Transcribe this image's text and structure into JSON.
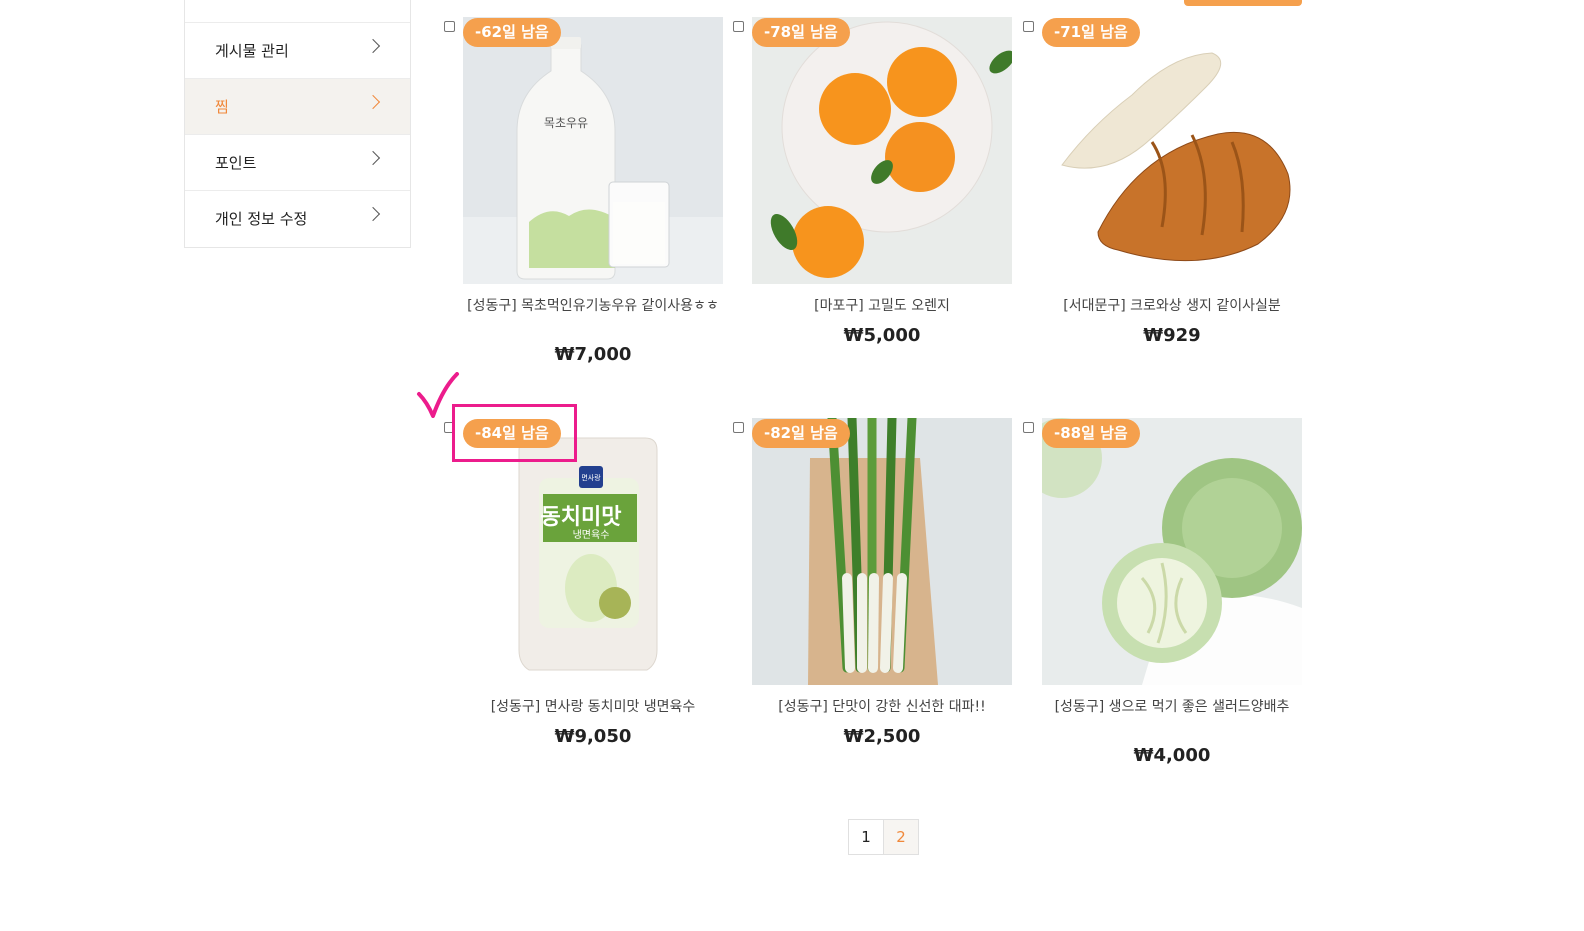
{
  "sidebar": {
    "items": [
      {
        "label": "게시물 관리"
      },
      {
        "label": "찜"
      },
      {
        "label": "포인트"
      },
      {
        "label": "개인 정보 수정"
      }
    ]
  },
  "products": [
    {
      "badge": "-62일 남음",
      "name": "[성동구] 목초먹인유기농우유 같이사용ㅎㅎ",
      "price": "₩7,000",
      "image": "milk-bottle"
    },
    {
      "badge": "-78일 남음",
      "name": "[마포구] 고밀도 오렌지",
      "price": "₩5,000",
      "image": "oranges"
    },
    {
      "badge": "-71일 남음",
      "name": "[서대문구] 크로와상 생지 같이사실분",
      "price": "₩929",
      "image": "croissants"
    },
    {
      "badge": "-84일 남음",
      "name": "[성동구] 면사랑 동치미맛 냉면육수",
      "price": "₩9,050",
      "image": "broth-pack"
    },
    {
      "badge": "-82일 남음",
      "name": "[성동구] 단맛이 강한 신선한 대파!!",
      "price": "₩2,500",
      "image": "green-onions"
    },
    {
      "badge": "-88일 남음",
      "name": "[성동구] 생으로 먹기 좋은 샐러드양배추",
      "price": "₩4,000",
      "image": "cabbage"
    }
  ],
  "package_text": {
    "brand": "면사랑",
    "title": "동치미맛",
    "subtitle": "냉면육수"
  },
  "milk_label": "목초우유",
  "pagination": {
    "pages": [
      "1",
      "2"
    ],
    "current": "1"
  },
  "colors": {
    "accent": "#f5a04d",
    "active_text": "#f0883a",
    "annotation": "#ec1c8c"
  }
}
